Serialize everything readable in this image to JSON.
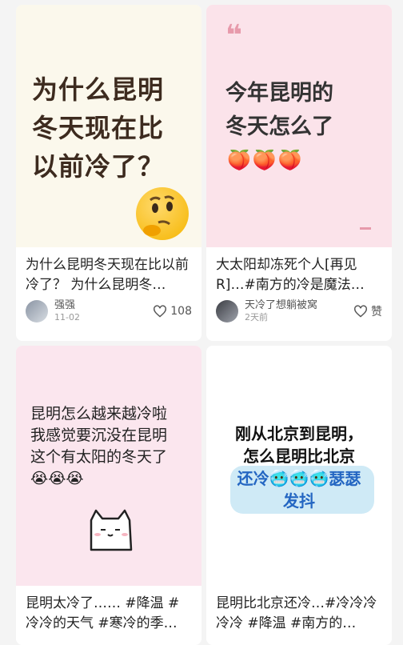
{
  "cards": [
    {
      "cover_text": [
        "为什么昆明",
        "冬天现在比",
        "以前冷了？"
      ],
      "cover_highlight": "昆明",
      "cover_emoji_name": "thinking-face-icon",
      "title": "为什么昆明冬天现在比以前冷了？ 为什么昆明冬…",
      "author": "强强",
      "date": "11-02",
      "likes": "108"
    },
    {
      "cover_quote": "❝",
      "cover_text": [
        "今年昆明的",
        "冬天怎么了"
      ],
      "cover_emojis": "🍑🍑🍑",
      "title": "大太阳却冻死个人[再见R]…#南方的冷是魔法…",
      "author": "天冷了想躺被窝",
      "date": "2天前",
      "likes": "赞"
    },
    {
      "cover_text": [
        "昆明怎么越来越冷啦",
        "我感觉要沉没在昆明",
        "这个有太阳的冬天了"
      ],
      "cover_emojis": "😭😭😭",
      "title": "昆明太冷了…… #降温 #冷冷的天气 #寒冷的季…",
      "author": "",
      "date": "",
      "likes": ""
    },
    {
      "cover_text": [
        "刚从北京到昆明，",
        "怎么昆明比北京",
        "还冷🥶🥶🥶瑟瑟",
        "发抖"
      ],
      "title": "昆明比北京还冷…#冷冷冷冷冷 #降温 #南方的…",
      "author": "",
      "date": "",
      "likes": ""
    }
  ]
}
